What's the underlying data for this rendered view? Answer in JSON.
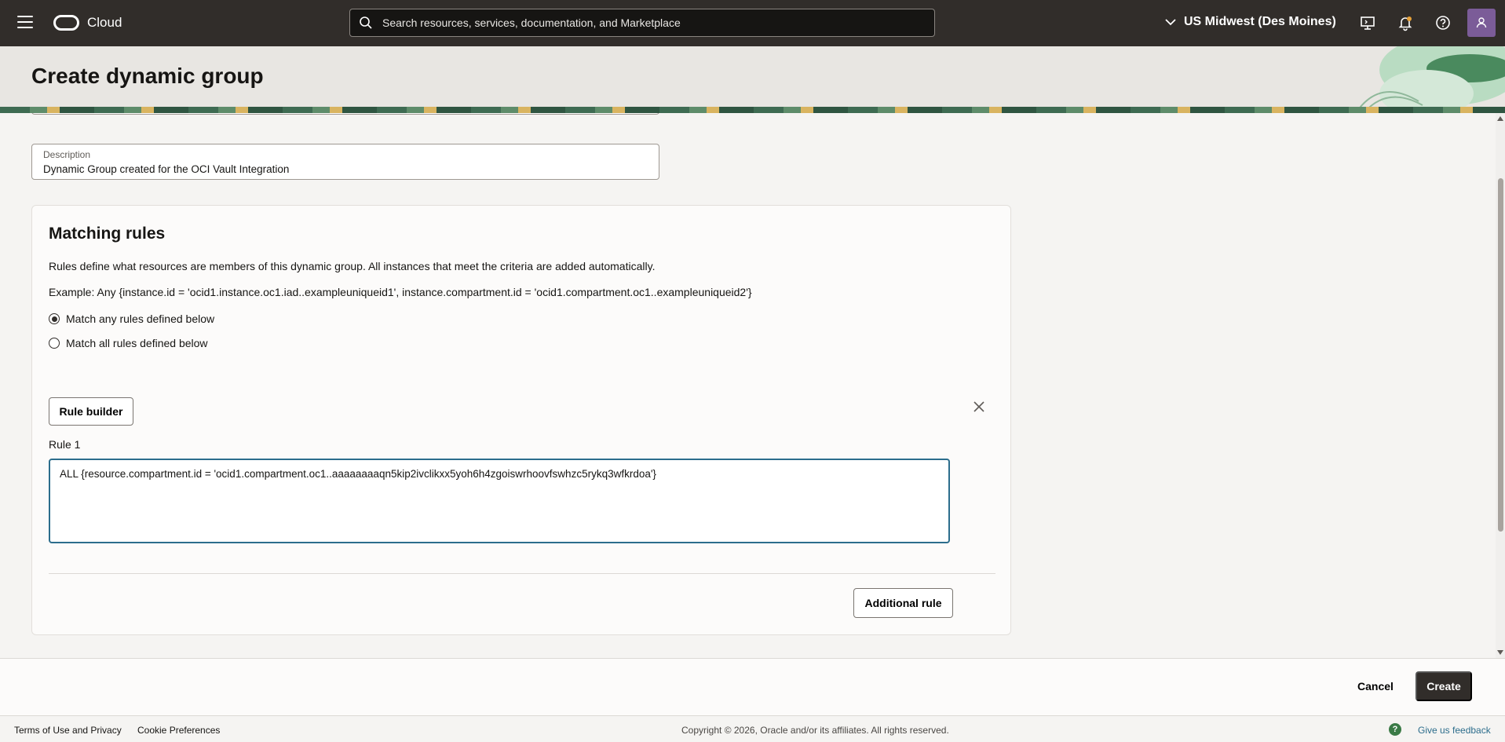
{
  "topbar": {
    "brand": "Cloud",
    "search_placeholder": "Search resources, services, documentation, and Marketplace",
    "region": "US Midwest (Des Moines)"
  },
  "page": {
    "title": "Create dynamic group"
  },
  "form": {
    "description_label": "Description",
    "description_value": "Dynamic Group created for the OCI Vault Integration"
  },
  "matching_rules": {
    "title": "Matching rules",
    "description": "Rules define what resources are members of this dynamic group. All instances that meet the criteria are added automatically.",
    "example": "Example: Any {instance.id = 'ocid1.instance.oc1.iad..exampleuniqueid1', instance.compartment.id = 'ocid1.compartment.oc1..exampleuniqueid2'}",
    "options": [
      {
        "label": "Match any rules defined below",
        "selected": true
      },
      {
        "label": "Match all rules defined below",
        "selected": false
      }
    ],
    "rule_builder_label": "Rule builder",
    "rule_label": "Rule 1",
    "rule_value": "ALL {resource.compartment.id = 'ocid1.compartment.oc1..aaaaaaaaqn5kip2ivclikxx5yoh6h4zgoiswrhoovfswhzc5rykq3wfkrdoa'}",
    "additional_rule_label": "Additional rule"
  },
  "actions": {
    "cancel": "Cancel",
    "create": "Create"
  },
  "footer": {
    "terms": "Terms of Use and Privacy",
    "cookies": "Cookie Preferences",
    "copyright": "Copyright © 2026, Oracle and/or its affiliates. All rights reserved.",
    "feedback_icon": "?",
    "feedback": "Give us feedback"
  },
  "colors": {
    "topbar": "#312d2a",
    "focus": "#2c6d8c",
    "primary_button": "#312d2a",
    "avatar": "#7b5c98"
  }
}
